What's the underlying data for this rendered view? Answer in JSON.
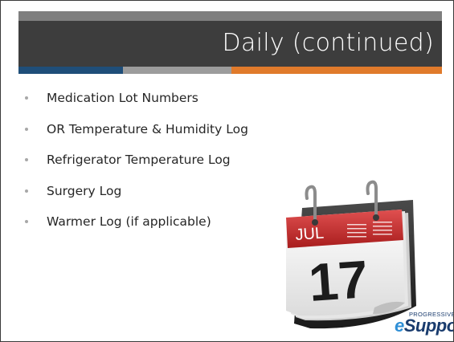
{
  "slide": {
    "title": "Daily (continued)",
    "bullets": [
      "Medication Lot Numbers",
      "OR Temperature & Humidity Log",
      "Refrigerator Temperature Log",
      "Surgery Log",
      "Warmer Log (if applicable)"
    ]
  },
  "calendar": {
    "month": "JUL",
    "day": "17"
  },
  "logo": {
    "small": "PROGRESSIVE",
    "prefix": "e",
    "main": "Support"
  },
  "colors": {
    "title_bar": "#3d3d3d",
    "accent_blue": "#1f4e79",
    "accent_gray": "#9c9c9c",
    "accent_orange": "#e07a2b",
    "calendar_red": "#c62a2a"
  }
}
